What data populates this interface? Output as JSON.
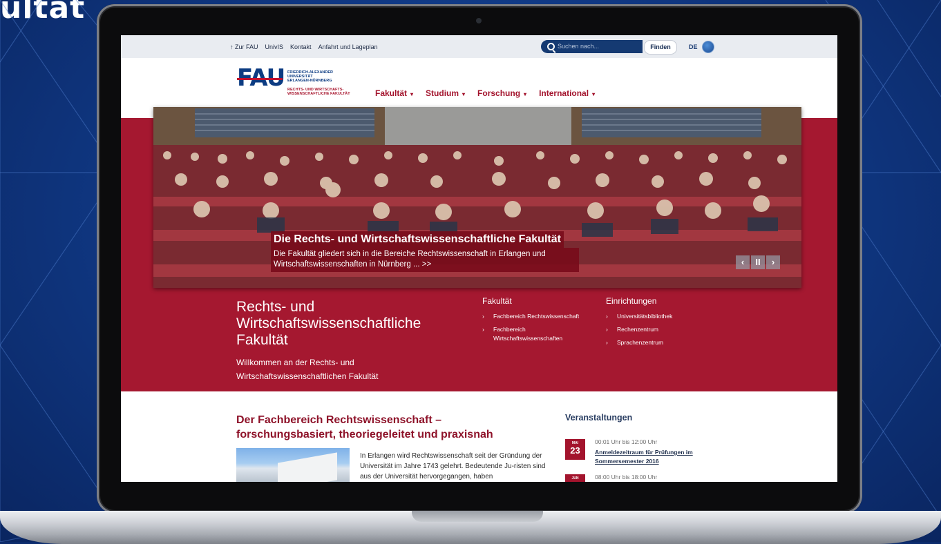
{
  "background": {
    "title": "ultät"
  },
  "topbar": {
    "links": [
      "↑ Zur FAU",
      "UnivIS",
      "Kontakt",
      "Anfahrt und Lageplan"
    ],
    "search_placeholder": "Suchen nach...",
    "search_button": "Finden",
    "language": "DE"
  },
  "header": {
    "logo_main": "FAU",
    "logo_lines": [
      "FRIEDRICH-ALEXANDER",
      "UNIVERSITÄT",
      "ERLANGEN-NÜRNBERG"
    ],
    "logo_sub": [
      "RECHTS- UND WIRTSCHAFTS-",
      "WISSENSCHAFTLICHE FAKULTÄT"
    ],
    "nav": [
      "Fakultät",
      "Studium",
      "Forschung",
      "International"
    ],
    "nav_caret": "▾"
  },
  "hero": {
    "title": "Die Rechts- und Wirtschaftswissenschaftliche Fakultät",
    "text": "Die Fakultät gliedert sich in die Bereiche Rechtswissenschaft in Erlangen und Wirtschaftswissenschaften in Nürnberg ... >>",
    "controls": [
      "‹",
      "II",
      "›"
    ]
  },
  "faculty": {
    "title": "Rechts- und Wirtschaftswissenschaftliche Fakultät",
    "subtitle": "Willkommen an der Rechts- und Wirtschaftswissenschaftlichen Fakultät",
    "columns": [
      {
        "heading": "Fakultät",
        "links": [
          "Fachbereich Rechtswissenschaft",
          "Fachbereich Wirtschaftswissenschaften"
        ]
      },
      {
        "heading": "Einrichtungen",
        "links": [
          "Universitätsbibliothek",
          "Rechenzentrum",
          "Sprachenzentrum"
        ]
      }
    ],
    "link_arrow": "›"
  },
  "article": {
    "title": "Der Fachbereich Rechtswissenschaft – forschungsbasiert, theoriegeleitet und praxisnah",
    "text": "In Erlangen wird Rechtswissenschaft seit der Gründung der Universität im Jahre 1743 gelehrt. Bedeutende Ju-risten sind aus der Universität hervorgegangen, haben"
  },
  "events": {
    "title": "Veranstaltungen",
    "items": [
      {
        "month": "MAI",
        "day": "23",
        "time": "00:01 Uhr bis 12:00 Uhr",
        "name": "Anmeldezeitraum für Prüfungen im Sommersemester 2016"
      },
      {
        "month": "JUN",
        "day": "",
        "time": "08:00 Uhr bis 18:00 Uhr",
        "name": ""
      }
    ]
  },
  "colors": {
    "brand_red": "#a51830",
    "brand_blue": "#0d3c82",
    "background_blue": "#0f3680"
  }
}
